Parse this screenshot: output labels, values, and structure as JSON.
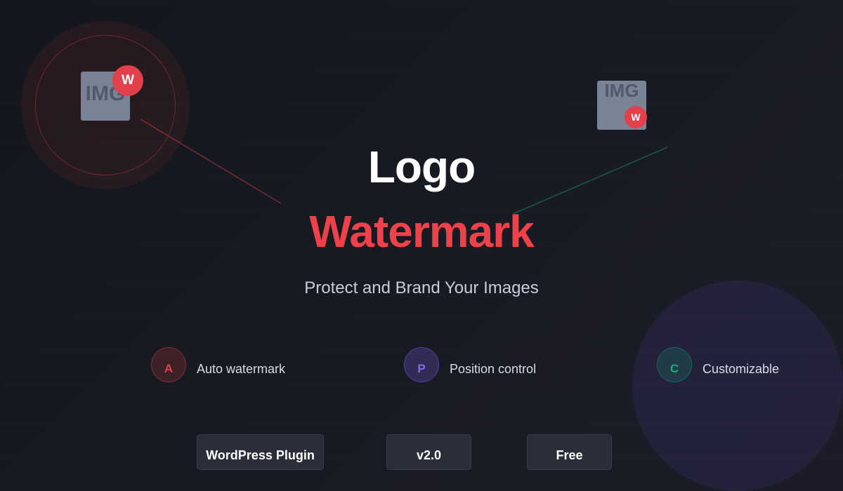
{
  "hero": {
    "title_line1": "Logo",
    "title_line2": "Watermark",
    "subtitle": "Protect and Brand Your Images"
  },
  "illustration": {
    "left_tile": {
      "text": "IMG",
      "badge": "W"
    },
    "right_tile": {
      "text": "IMG",
      "badge": "W"
    }
  },
  "features": [
    {
      "letter": "A",
      "label": "Auto watermark",
      "color": "#e2404a"
    },
    {
      "letter": "P",
      "label": "Position control",
      "color": "#8b66ee"
    },
    {
      "letter": "C",
      "label": "Customizable",
      "color": "#12b07f"
    }
  ],
  "tags": [
    {
      "label": "WordPress Plugin"
    },
    {
      "label": "v2.0"
    },
    {
      "label": "Free"
    }
  ],
  "colors": {
    "background": "#16181f",
    "accent_red": "#ef4149",
    "accent_purple": "#8b66ee",
    "accent_green": "#12b07f"
  }
}
